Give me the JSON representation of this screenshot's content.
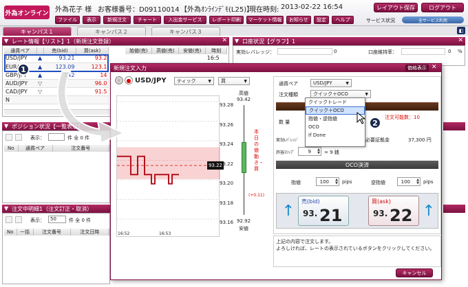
{
  "header": {
    "logo": "外為オンライン",
    "user_name": "外為花子 様",
    "customer_no": "お客様番号：D09110014",
    "account": "【外為ｵﾝﾗｲﾝﾃﾞﾓ(L25)】",
    "time_label": "現在時刻:",
    "time_value": "2013-02-22 16:54",
    "layout_save": "レイアウト保存",
    "logout": "ログアウト",
    "menu": [
      "ファイル",
      "表示",
      "新規注文",
      "チャート",
      "入出金サービス",
      "レポート印刷",
      "マーケット情報",
      "お知らせ",
      "設定",
      "ヘルプ"
    ],
    "service_label": "サービス状況",
    "service_status": "全サービス利用"
  },
  "tabs": [
    "キャンパス１",
    "キャンパス２",
    "キャンパス３"
  ],
  "rate_panel": {
    "title": "レート情報【リスト】1（新規注文登録）",
    "headers": [
      "通貨ペア",
      "売(bid)",
      "買(ask)"
    ],
    "rows": [
      {
        "pair": "USD/JPY",
        "bid": "93.21",
        "ask": "93.2"
      },
      {
        "pair": "EUR/JPY",
        "bid": "123.09",
        "ask": "123.1"
      },
      {
        "pair": "GBP/JPY",
        "bid": "142",
        "ask": "14"
      },
      {
        "pair": "AUD/JPY",
        "bid": "",
        "ask": "96.0"
      },
      {
        "pair": "CAD/JPY",
        "bid": "",
        "ask": "91.5"
      },
      {
        "pair": "N",
        "bid": "",
        "ask": ""
      }
    ],
    "extra_headers": [
      "始値(売)",
      "高値(売)",
      "安値(売)",
      "時刻"
    ],
    "extra_row": "16:5"
  },
  "account_panel": {
    "title": "口座状況【グラフ】1",
    "leverage_label": "実効レバレッジ：",
    "leverage_value": "0",
    "maintenance_label": "口座維持率：",
    "maintenance_value": "0",
    "pct": "%"
  },
  "position_panel": {
    "title": "ポジション状況【一覧表示】",
    "display": "表示：",
    "count": "件 全 0 件",
    "headers": [
      "No",
      "通貨ペア",
      "注文番号"
    ]
  },
  "order_panel": {
    "title": "注文中明細1（注文訂正・取消）",
    "display": "表示：",
    "page_size": "50",
    "count": "件 全 0 件",
    "headers": [
      "No",
      "一括",
      "注文番号",
      "注文日時"
    ]
  },
  "modal": {
    "title": "新規注文入力",
    "symbol": "USD/JPY",
    "tick": "ティック",
    "side": "買",
    "high_label": "高値",
    "high_value": "93.42",
    "low_label": "安値",
    "low_value": "92.92",
    "y_ticks": [
      "93.28",
      "93.26",
      "93.24",
      "93.22",
      "93.20",
      "93.18",
      "93.16"
    ],
    "current_price": "93.22",
    "x_ticks": [
      "16:52",
      "16:53"
    ],
    "side_text": "本日の値動き・買",
    "side_change": "(+0.11)",
    "currency_pair_label": "通貨ペア",
    "currency_pair": "USD/JPY",
    "order_type_label": "注文種類",
    "order_type": "クイック＋OCO",
    "amount_label": "数 量",
    "effective_leverage_label": "実効ﾚﾊﾞﾚｯｼﾞ",
    "slippage_label": "許容ｽﾘｯﾌﾟ",
    "slippage_value": "9",
    "slippage_unit": "= 9 銭",
    "margin_label": "必要証拠金",
    "margin_value": "37,300 円",
    "available_label": "注文可能数：10",
    "detail_button": "価格表示",
    "dropdown": [
      "クイックトレード",
      "クイック＋OCO",
      "指値・逆指値",
      "OCO",
      "If Done"
    ],
    "oco_title": "OCO決済",
    "limit_label": "指値",
    "limit_value": "100",
    "stop_label": "逆指値",
    "stop_value": "100",
    "pips": "pips",
    "bid_label": "売(bid)",
    "bid_big": "21",
    "bid_small": "93.",
    "ask_label": "買(ask)",
    "ask_big": "22",
    "ask_small": "93.",
    "confirm_line1": "上記の内容で注文します。",
    "confirm_line2": "よろしければ、レートの表示されているボタンをクリックしてください。",
    "cancel": "キャンセル"
  },
  "badges": [
    "1",
    "2"
  ],
  "chart_data": {
    "type": "line",
    "title": "",
    "x": [
      "16:52",
      "16:53"
    ],
    "ylim": [
      93.15,
      93.29
    ],
    "series": [
      {
        "values": [
          93.23,
          93.23,
          93.23,
          93.23,
          93.21,
          93.21,
          93.23,
          93.23,
          93.21,
          93.21,
          93.2,
          93.21,
          93.21,
          93.21,
          93.21,
          93.2,
          93.21,
          93.21,
          93.21
        ]
      }
    ],
    "current": 93.22,
    "band": [
      93.205,
      93.24
    ]
  }
}
